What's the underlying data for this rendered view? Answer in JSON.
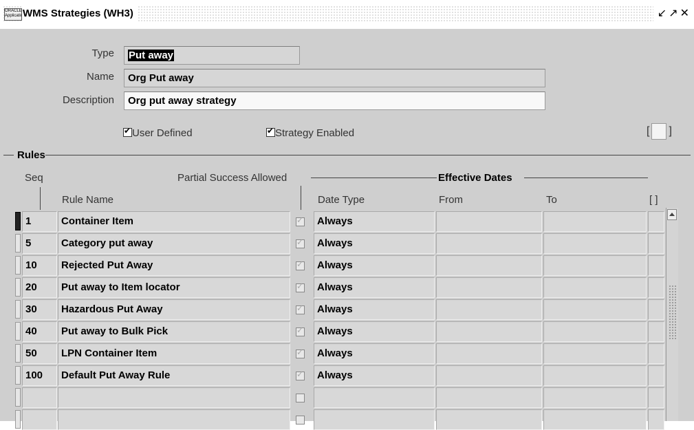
{
  "window": {
    "title": "WMS Strategies (WH3)",
    "app_icon_label": "ORACLE Applications",
    "controls": [
      "↙",
      "↗",
      "✕"
    ]
  },
  "header": {
    "type_label": "Type",
    "type_value": "Put away",
    "name_label": "Name",
    "name_value": "Org Put away",
    "description_label": "Description",
    "description_value": "Org put away strategy",
    "user_defined_label": "User Defined",
    "user_defined_checked": true,
    "strategy_enabled_label": "Strategy Enabled",
    "strategy_enabled_checked": true,
    "folder_left": "[",
    "folder_right": "]"
  },
  "rules": {
    "section_label": "Rules",
    "col_seq": "Seq",
    "col_rule_name": "Rule Name",
    "col_partial": "Partial Success Allowed",
    "group_effective": "Effective Dates",
    "col_date_type": "Date Type",
    "col_from": "From",
    "col_to": "To",
    "col_flex": "[ ]",
    "rows": [
      {
        "seq": "1",
        "name": "Container Item",
        "partial": true,
        "date_type": "Always",
        "from": "",
        "to": ""
      },
      {
        "seq": "5",
        "name": "Category put away",
        "partial": true,
        "date_type": "Always",
        "from": "",
        "to": ""
      },
      {
        "seq": "10",
        "name": "Rejected Put Away",
        "partial": true,
        "date_type": "Always",
        "from": "",
        "to": ""
      },
      {
        "seq": "20",
        "name": "Put away to Item locator",
        "partial": true,
        "date_type": "Always",
        "from": "",
        "to": ""
      },
      {
        "seq": "30",
        "name": "Hazardous Put Away",
        "partial": true,
        "date_type": "Always",
        "from": "",
        "to": ""
      },
      {
        "seq": "40",
        "name": "Put away to Bulk Pick",
        "partial": true,
        "date_type": "Always",
        "from": "",
        "to": ""
      },
      {
        "seq": "50",
        "name": "LPN Container Item",
        "partial": true,
        "date_type": "Always",
        "from": "",
        "to": ""
      },
      {
        "seq": "100",
        "name": "Default Put Away Rule",
        "partial": true,
        "date_type": "Always",
        "from": "",
        "to": ""
      },
      {
        "seq": "",
        "name": "",
        "partial": false,
        "date_type": "",
        "from": "",
        "to": ""
      },
      {
        "seq": "",
        "name": "",
        "partial": false,
        "date_type": "",
        "from": "",
        "to": ""
      }
    ]
  }
}
